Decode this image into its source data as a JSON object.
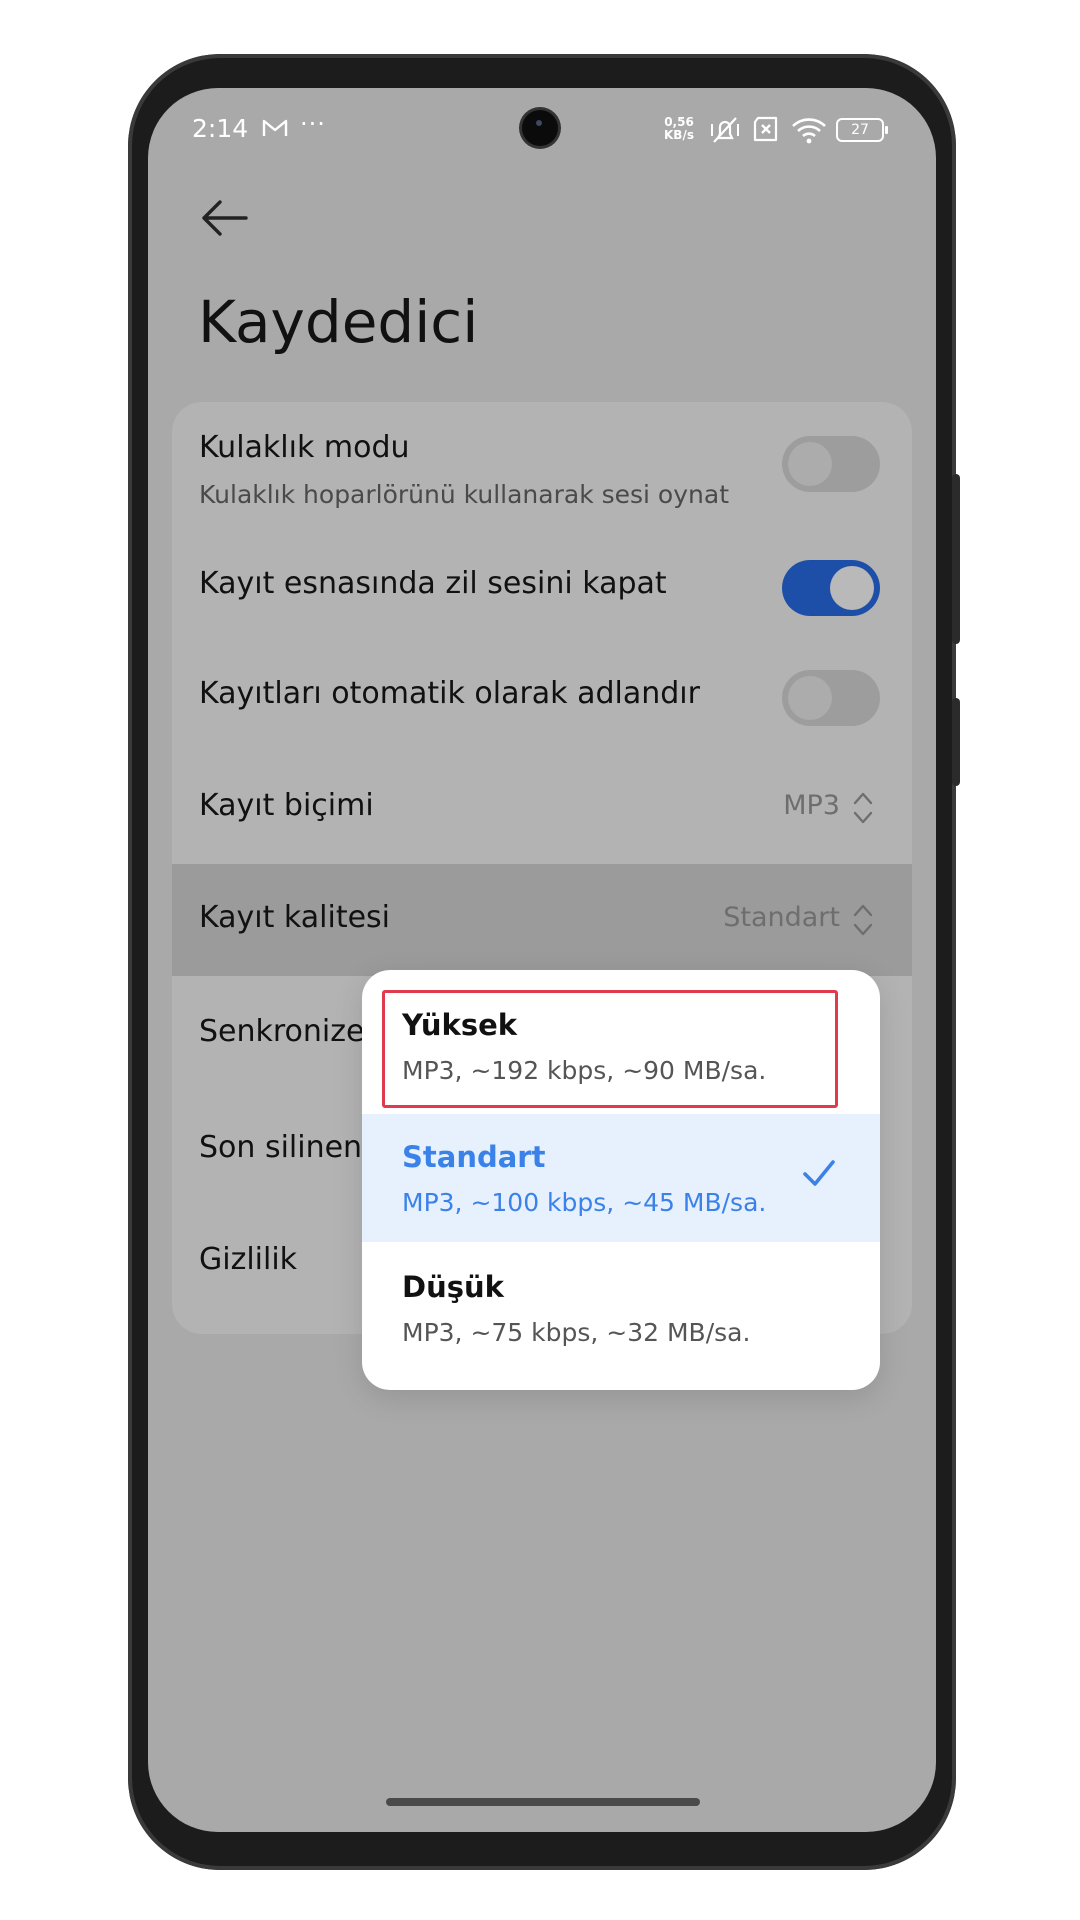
{
  "status_bar": {
    "time": "2:14",
    "net_speed_value": "0,56",
    "net_speed_unit": "KB/s",
    "battery": "27",
    "icons": [
      "gmail-icon",
      "more-dots-icon",
      "vibrate-off-icon",
      "sim-x-icon",
      "wifi-icon",
      "battery-icon"
    ]
  },
  "header": {
    "title": "Kaydedici",
    "back_icon": "arrow-left-icon"
  },
  "settings": {
    "headphone_mode": {
      "title": "Kulaklık modu",
      "subtitle": "Kulaklık hoparlörünü kullanarak sesi oynat",
      "enabled": false
    },
    "mute_ringer": {
      "title": "Kayıt esnasında zil sesini kapat",
      "enabled": true
    },
    "auto_name": {
      "title": "Kayıtları otomatik olarak adlandır",
      "enabled": false
    },
    "format": {
      "title": "Kayıt biçimi",
      "value": "MP3"
    },
    "quality": {
      "title": "Kayıt kalitesi",
      "value": "Standart"
    },
    "sync": {
      "title": "Senkronize"
    },
    "recently_deleted": {
      "title": "Son silinen"
    },
    "privacy": {
      "title": "Gizlilik"
    }
  },
  "quality_popup": {
    "options": [
      {
        "title": "Yüksek",
        "subtitle": "MP3, ~192 kbps, ~90 MB/sa.",
        "selected": false
      },
      {
        "title": "Standart",
        "subtitle": "MP3, ~100 kbps, ~45 MB/sa.",
        "selected": true
      },
      {
        "title": "Düşük",
        "subtitle": "MP3, ~75 kbps, ~32 MB/sa.",
        "selected": false
      }
    ],
    "highlight_color": "#e03a4e",
    "accent_color": "#3b82e8"
  }
}
